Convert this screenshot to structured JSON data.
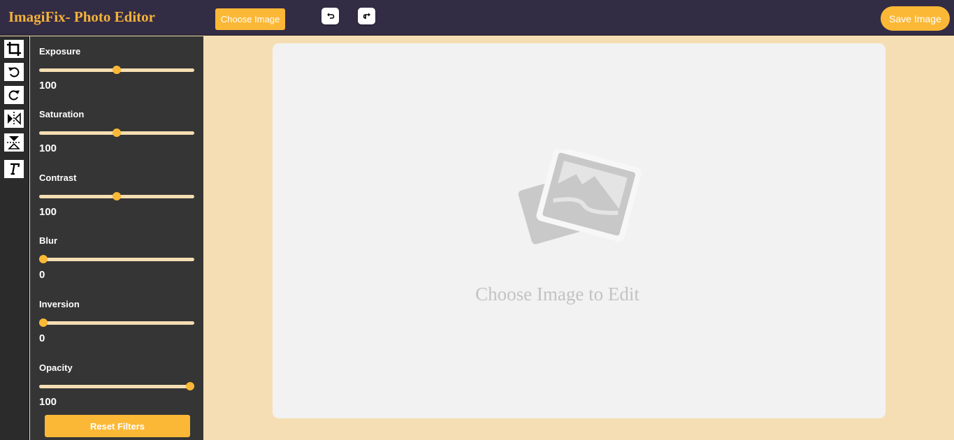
{
  "header": {
    "title": "ImagiFix- Photo Editor",
    "choose_label": "Choose Image",
    "save_label": "Save Image"
  },
  "toolbar": {
    "tools": [
      {
        "name": "crop",
        "icon": "crop-icon"
      },
      {
        "name": "rotate-left",
        "icon": "rotate-left-icon"
      },
      {
        "name": "rotate-right",
        "icon": "rotate-right-icon"
      },
      {
        "name": "flip-horizontal",
        "icon": "flip-horizontal-icon"
      },
      {
        "name": "flip-vertical",
        "icon": "flip-vertical-icon"
      },
      {
        "name": "text",
        "icon": "text-icon"
      }
    ]
  },
  "filters": [
    {
      "label": "Exposure",
      "value": "100",
      "level": 0.5
    },
    {
      "label": "Saturation",
      "value": "100",
      "level": 0.5
    },
    {
      "label": "Contrast",
      "value": "100",
      "level": 0.5
    },
    {
      "label": "Blur",
      "value": "0",
      "level": 0.0
    },
    {
      "label": "Inversion",
      "value": "0",
      "level": 0.0
    },
    {
      "label": "Opacity",
      "value": "100",
      "level": 1.0
    }
  ],
  "reset_label": "Reset Filters",
  "canvas": {
    "placeholder_text": "Choose Image to Edit"
  },
  "colors": {
    "accent": "#fbb836",
    "header_bg": "#332c45",
    "panel_bg": "#353535",
    "page_bg": "#f5deb3"
  }
}
